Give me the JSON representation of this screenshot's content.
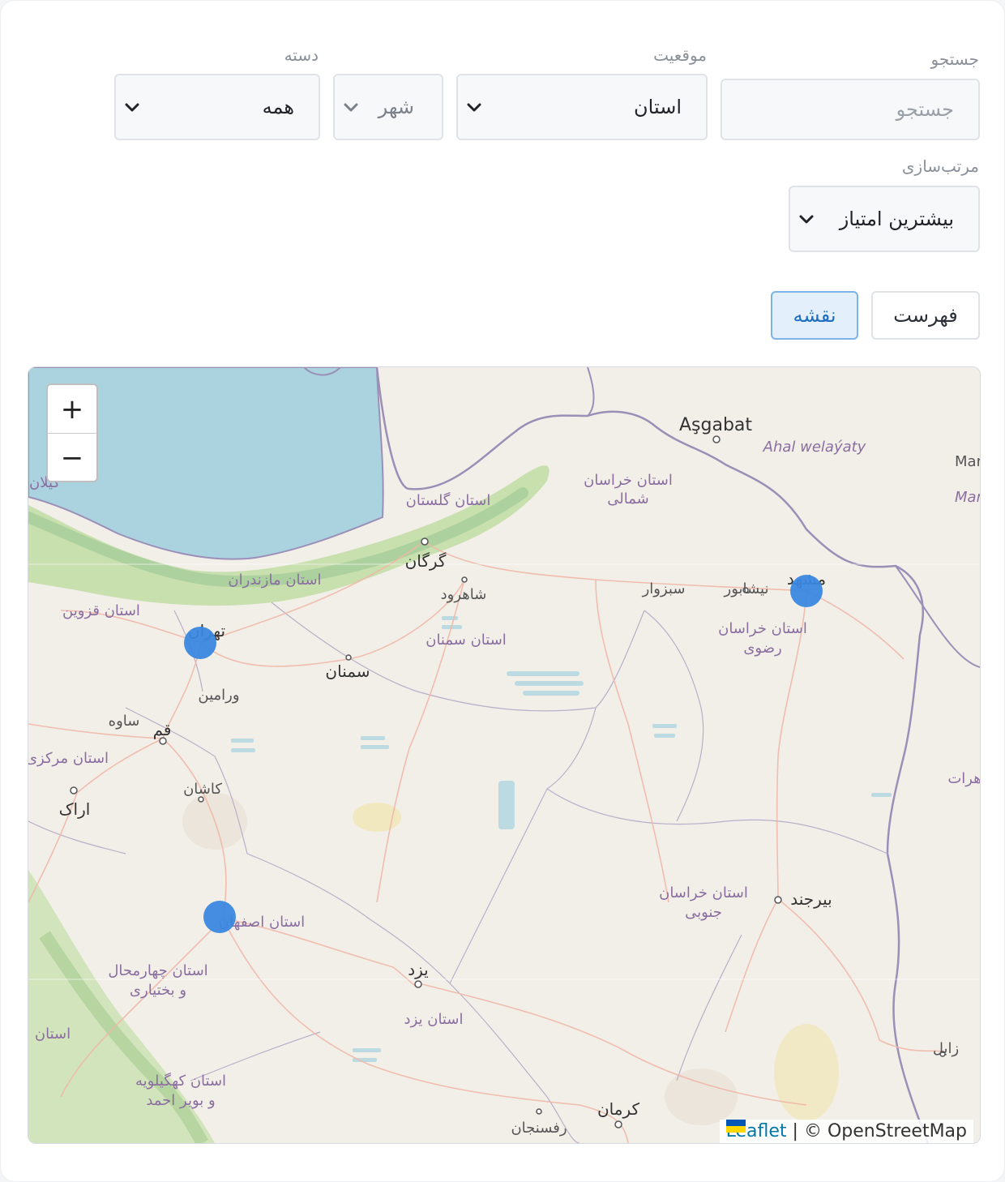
{
  "filters": {
    "search": {
      "label": "جستجو",
      "placeholder": "جستجو"
    },
    "location": {
      "label": "موقعیت",
      "province_value": "استان",
      "city_value": "شهر"
    },
    "category": {
      "label": "دسته",
      "value": "همه"
    },
    "sort": {
      "label": "مرتب‌سازی",
      "value": "بیشترین امتیاز"
    }
  },
  "view_toggle": {
    "list_label": "فهرست",
    "map_label": "نقشه",
    "active": "map"
  },
  "map": {
    "zoom_in": "+",
    "zoom_out": "−",
    "attribution_link": "Leaflet",
    "attribution_sep": " | ",
    "attribution_text": "© OpenStreetMap",
    "marker_count": 3,
    "marker_color": "#3a87e0",
    "labels": {
      "ashgabat": "Aşgabat",
      "ahal": "Ahal welaýaty",
      "mary": "Mar",
      "mary2": "Mar",
      "khorasan_north_1": "استان خراسان",
      "khorasan_north_2": "شمالی",
      "golestan": "استان گلستان",
      "gorgan": "گرگان",
      "shahrud": "شاهرود",
      "sabzevar": "سبزوار",
      "neyshabur": "نیشابور",
      "mashhad": "مشهد",
      "khorasan_razavi_1": "استان خراسان",
      "khorasan_razavi_2": "رضوی",
      "mazandaran": "استان مازندران",
      "qazvin": "استان قزوین",
      "tehran": "تهران",
      "semnan_prov": "استان سمنان",
      "semnan": "سمنان",
      "varamin": "ورامین",
      "saveh": "ساوه",
      "qom": "قم",
      "markazi": "استان مرکزی",
      "kashan": "کاشان",
      "arak": "اراک",
      "herat": "هرات",
      "birjand": "بیرجند",
      "khorasan_south_1": "استان خراسان",
      "khorasan_south_2": "جنوبی",
      "isfahan": "استان اصفهان",
      "chahar_1": "استان چهارمحال",
      "chahar_2": "و بختیاری",
      "yazd": "یزد",
      "yazd_prov": "استان یزد",
      "ostan_w": "استان",
      "zabol": "زابل",
      "kohgiluyeh_1": "استان کهگیلویه",
      "kohgiluyeh_2": "و بویر احمد",
      "kerman": "کرمان",
      "rafsanjan": "رفسنجان",
      "gilan": "گیلان"
    }
  }
}
